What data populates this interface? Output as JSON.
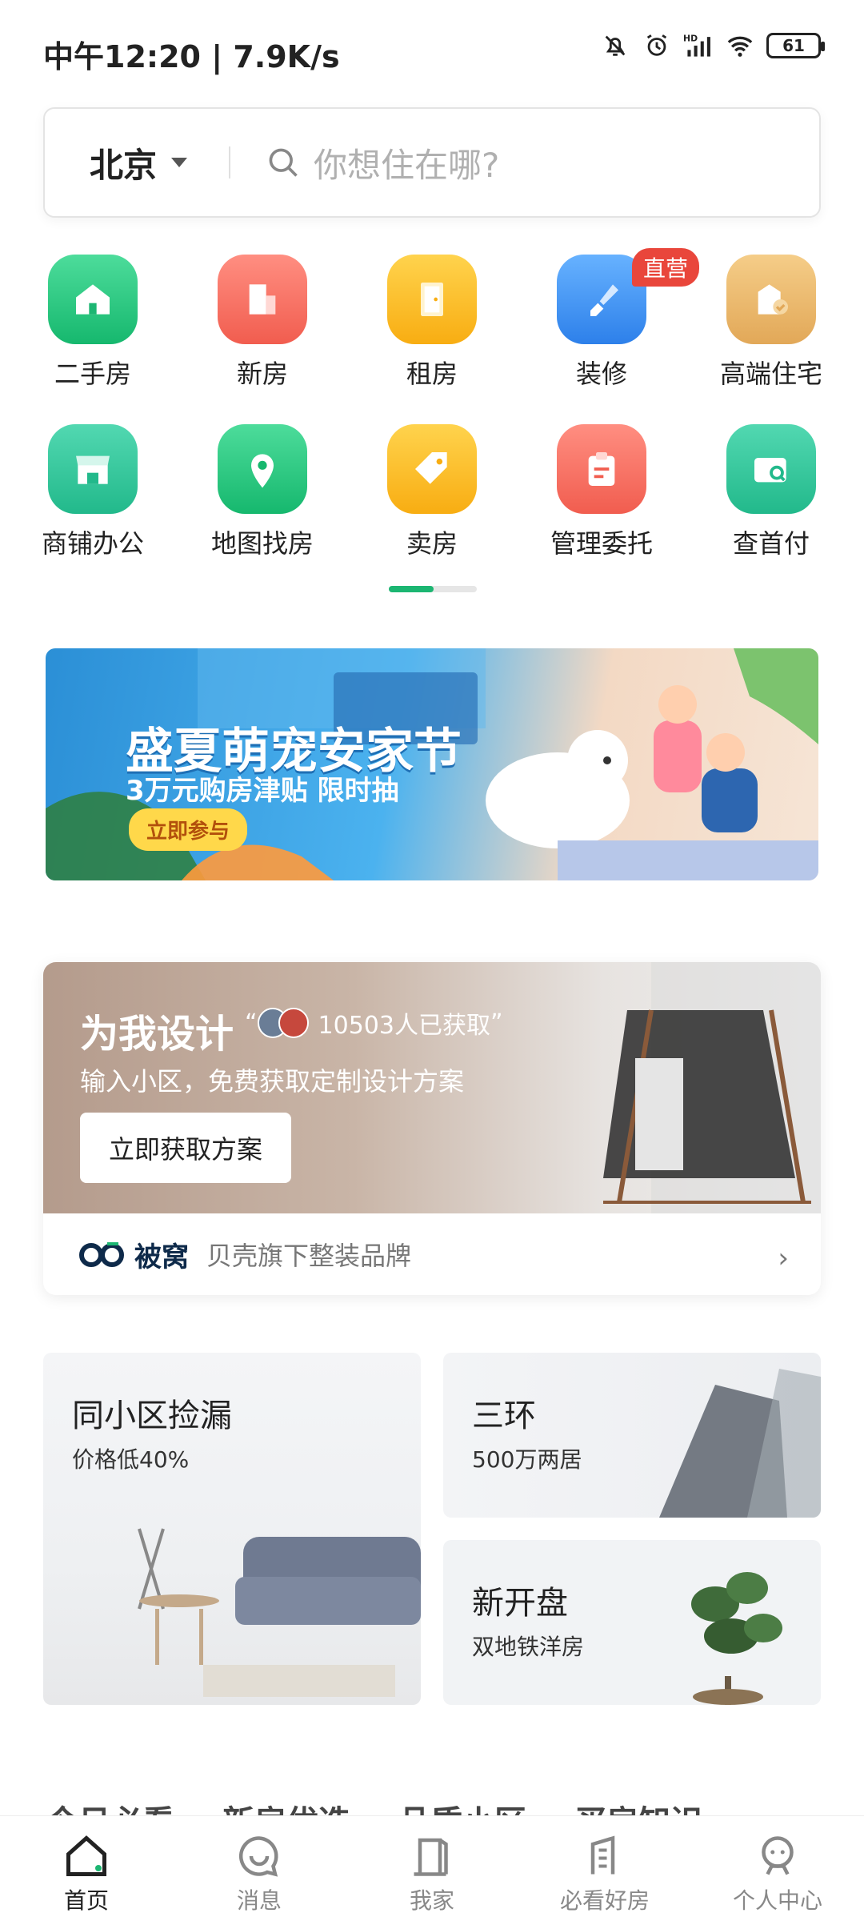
{
  "status_bar": {
    "time": "中午12:20",
    "speed": "7.9K/s",
    "battery": "61",
    "icons": [
      "mute-icon",
      "alarm-icon",
      "hd-signal-icon",
      "wifi-icon",
      "battery-icon"
    ]
  },
  "search": {
    "city": "北京",
    "placeholder": "你想住在哪?"
  },
  "grid": [
    {
      "label": "二手房",
      "icon": "house-icon",
      "color": "#23c37d"
    },
    {
      "label": "新房",
      "icon": "building-icon",
      "color": "#f46c5e"
    },
    {
      "label": "租房",
      "icon": "door-icon",
      "color": "#fbb824"
    },
    {
      "label": "装修",
      "icon": "brush-icon",
      "color": "#3a8ff1",
      "badge": "直营"
    },
    {
      "label": "高端住宅",
      "icon": "premium-house-icon",
      "color": "#e9b667"
    },
    {
      "label": "商铺办公",
      "icon": "shop-icon",
      "color": "#2fc59a"
    },
    {
      "label": "地图找房",
      "icon": "map-pin-icon",
      "color": "#21c27a"
    },
    {
      "label": "卖房",
      "icon": "tag-icon",
      "color": "#fbb824"
    },
    {
      "label": "管理委托",
      "icon": "clipboard-icon",
      "color": "#f46c5e"
    },
    {
      "label": "查首付",
      "icon": "wallet-search-icon",
      "color": "#2fc59a"
    }
  ],
  "banner": {
    "title": "盛夏萌宠安家节",
    "subtitle": "3万元购房津贴 限时抽",
    "cta": "立即参与"
  },
  "design": {
    "title": "为我设计",
    "count": "10503人已获取",
    "subtitle": "输入小区，免费获取定制设计方案",
    "button": "立即获取方案",
    "brand": "被窝",
    "tagline": "贝壳旗下整装品牌"
  },
  "cards": [
    {
      "title": "同小区捡漏",
      "subtitle": "价格低40%"
    },
    {
      "title": "三环",
      "subtitle": "500万两居"
    },
    {
      "title": "新开盘",
      "subtitle": "双地铁洋房"
    }
  ],
  "tabs": [
    "今日必看",
    "新房优选",
    "品质小区",
    "买房知识"
  ],
  "nav": [
    {
      "label": "首页",
      "icon": "home-icon",
      "active": true
    },
    {
      "label": "消息",
      "icon": "message-icon"
    },
    {
      "label": "我家",
      "icon": "my-home-icon"
    },
    {
      "label": "必看好房",
      "icon": "building-outline-icon"
    },
    {
      "label": "个人中心",
      "icon": "profile-icon"
    }
  ]
}
